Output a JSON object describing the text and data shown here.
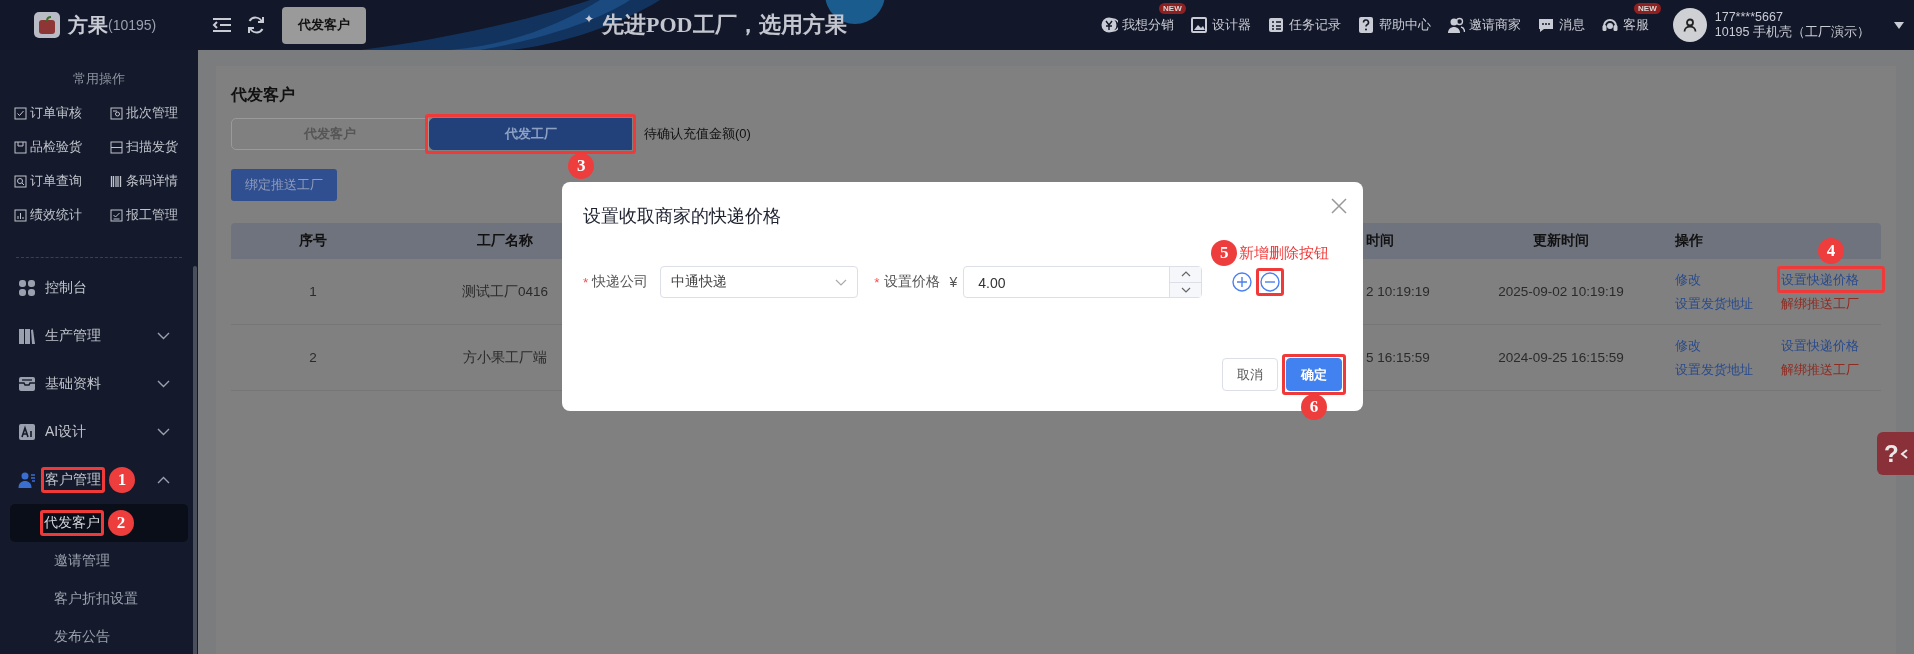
{
  "topbar": {
    "logo": {
      "name": "方果",
      "code": "(10195)"
    },
    "open_tabs": [
      {
        "label": "代发客户",
        "selected": true
      }
    ],
    "slogan_mark": "✦",
    "slogan": "先进POD工厂，选用方果",
    "links": [
      {
        "label": "我想分销",
        "badge": "NEW"
      },
      {
        "label": "设计器"
      },
      {
        "label": "任务记录"
      },
      {
        "label": "帮助中心"
      },
      {
        "label": "邀请商家"
      },
      {
        "label": "消息"
      },
      {
        "label": "客服",
        "badge": "NEW"
      }
    ],
    "user": {
      "phone": "177****5667",
      "company": "10195 手机壳（工厂演示）"
    }
  },
  "sidebar": {
    "shortcuts_title": "常用操作",
    "shortcuts": [
      "订单审核",
      "批次管理",
      "品检验货",
      "扫描发货",
      "订单查询",
      "条码详情",
      "绩效统计",
      "报工管理"
    ],
    "menu": [
      {
        "label": "控制台"
      },
      {
        "label": "生产管理",
        "expanded": false
      },
      {
        "label": "基础资料",
        "expanded": false
      },
      {
        "label": "AI设计",
        "expanded": false
      },
      {
        "label": "客户管理",
        "expanded": true,
        "callout": {
          "number": "1"
        },
        "children": [
          {
            "label": "代发客户",
            "selected": true,
            "callout": {
              "number": "2"
            }
          },
          {
            "label": "邀请管理",
            "selected": false
          },
          {
            "label": "客户折扣设置",
            "selected": false
          },
          {
            "label": "发布公告",
            "selected": false
          }
        ]
      }
    ]
  },
  "page": {
    "title": "代发客户",
    "tabs": [
      {
        "label": "代发客户",
        "selected": false
      },
      {
        "label": "代发工厂",
        "selected": true,
        "callout": {
          "number": "3"
        }
      }
    ],
    "pending": "待确认充值金额(0)",
    "bind_button": "绑定推送工厂",
    "table": {
      "columns": [
        "序号",
        "工厂名称",
        "时间",
        "更新时间",
        "操作"
      ],
      "rows": [
        {
          "cells": [
            "1",
            "测试工厂0416",
            "2 10:19:19",
            "2025-09-02 10:19:19"
          ],
          "actions": [
            {
              "label": "修改",
              "kind": "link"
            },
            {
              "label": "设置快递价格",
              "kind": "link",
              "callout": {
                "number": "4"
              }
            },
            {
              "label": "设置发货地址",
              "kind": "link"
            },
            {
              "label": "解绑推送工厂",
              "kind": "danger"
            }
          ]
        },
        {
          "cells": [
            "2",
            "方小果工厂端",
            "5 16:15:59",
            "2024-09-25 16:15:59"
          ],
          "actions": [
            {
              "label": "修改",
              "kind": "link"
            },
            {
              "label": "设置快递价格",
              "kind": "link"
            },
            {
              "label": "设置发货地址",
              "kind": "link"
            },
            {
              "label": "解绑推送工厂",
              "kind": "danger"
            }
          ]
        }
      ]
    }
  },
  "dialog": {
    "title": "设置收取商家的快递价格",
    "fields": [
      {
        "label": "快递公司",
        "required_mark": "*",
        "kind": "select",
        "value": "中通快递"
      },
      {
        "label": "设置价格",
        "required_mark": "*",
        "kind": "number",
        "prefix": "¥",
        "value": "4.00"
      }
    ],
    "row_buttons": [
      {
        "kind": "add"
      },
      {
        "kind": "remove",
        "callout": {
          "number": "5",
          "note": "新增删除按钮"
        }
      }
    ],
    "buttons": [
      {
        "label": "取消",
        "kind": "default"
      },
      {
        "label": "确定",
        "kind": "primary",
        "callout": {
          "number": "6"
        }
      }
    ]
  },
  "help_tab": "?"
}
